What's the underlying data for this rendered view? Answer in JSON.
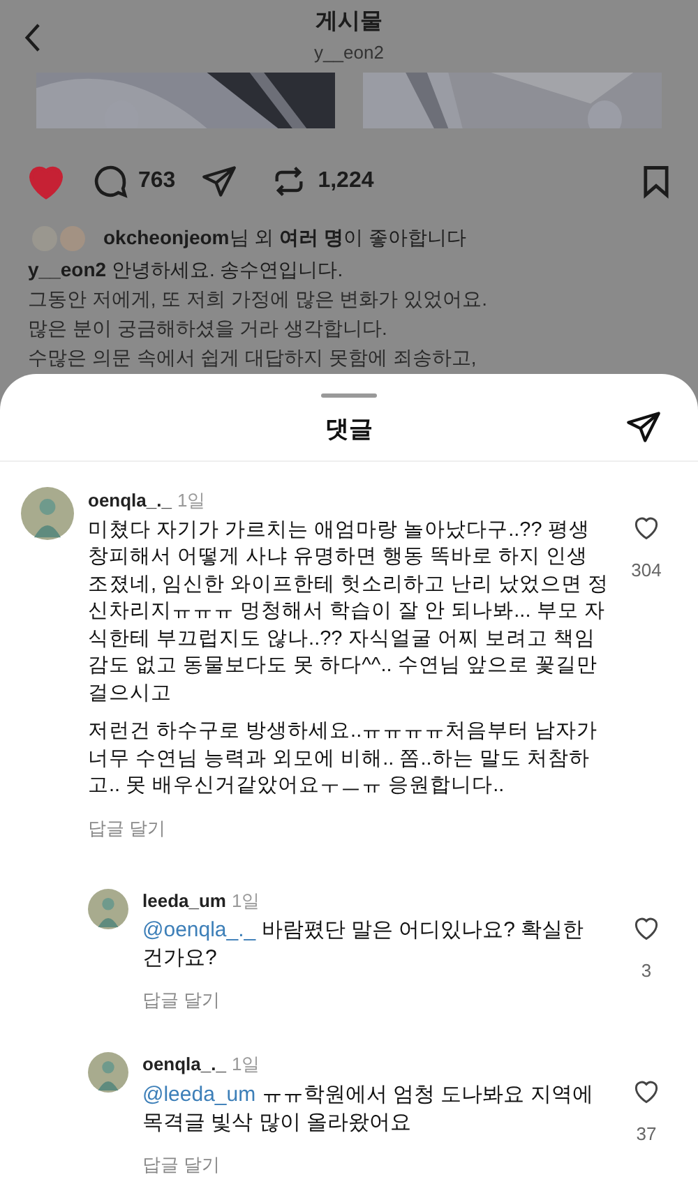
{
  "header": {
    "title": "게시물",
    "subtitle": "y__eon2"
  },
  "post": {
    "liked": true,
    "comment_count": "763",
    "repost_count": "1,224",
    "likes_text": "**okcheonjeom**님 외 **여러 명**이 좋아합니다",
    "caption": {
      "username": "y__eon2",
      "lines": [
        "안녕하세요. 송수연입니다.",
        "그동안 저에게, 또 저희 가정에 많은 변화가 있었어요.",
        "많은 분이 궁금해하셨을 거라 생각합니다.",
        "수많은 의문 속에서 쉽게 대답하지 못함에 죄송하고,"
      ]
    }
  },
  "sheet": {
    "title": "댓글"
  },
  "comments": [
    {
      "username": "oenqla_._",
      "time": "1일",
      "paragraphs": [
        "미쳤다 자기가 가르치는 애엄마랑 놀아났다구..?? 평생 창피해서 어떻게 사냐 유명하면 행동 똑바로 하지 인생 조졌네, 임신한 와이프한테 헛소리하고 난리 났었으면 정신차리지ㅠㅠㅠ 멍청해서 학습이 잘 안 되나봐... 부모 자식한테 부끄럽지도 않나..?? 자식얼굴 어찌 보려고 책임감도 없고 동물보다도 못 하다^^.. 수연님 앞으로 꽃길만 걸으시고",
        "저런건 하수구로 방생하세요..ㅠㅠㅠㅠ처음부터 남자가 너무 수연님 능력과 외모에 비해.. 쫌..하는 말도 처참하고.. 못 배우신거같았어요ㅜㅡㅠ 응원합니다.."
      ],
      "reply_label": "답글 달기",
      "likes": "304",
      "liked": false,
      "replies": [
        {
          "username": "leeda_um",
          "time": "1일",
          "mention": "@oenqla_._",
          "text": "바람폈단 말은 어디있나요? 확실한 건가요?",
          "reply_label": "답글 달기",
          "likes": "3",
          "liked": false
        },
        {
          "username": "oenqla_._",
          "time": "1일",
          "mention": "@leeda_um",
          "text": "ㅠㅠ학원에서 엄청 도나봐요 지역에 목격글 빛삭 많이 올라왔어요",
          "reply_label": "답글 달기",
          "likes": "37",
          "liked": false
        }
      ]
    }
  ]
}
